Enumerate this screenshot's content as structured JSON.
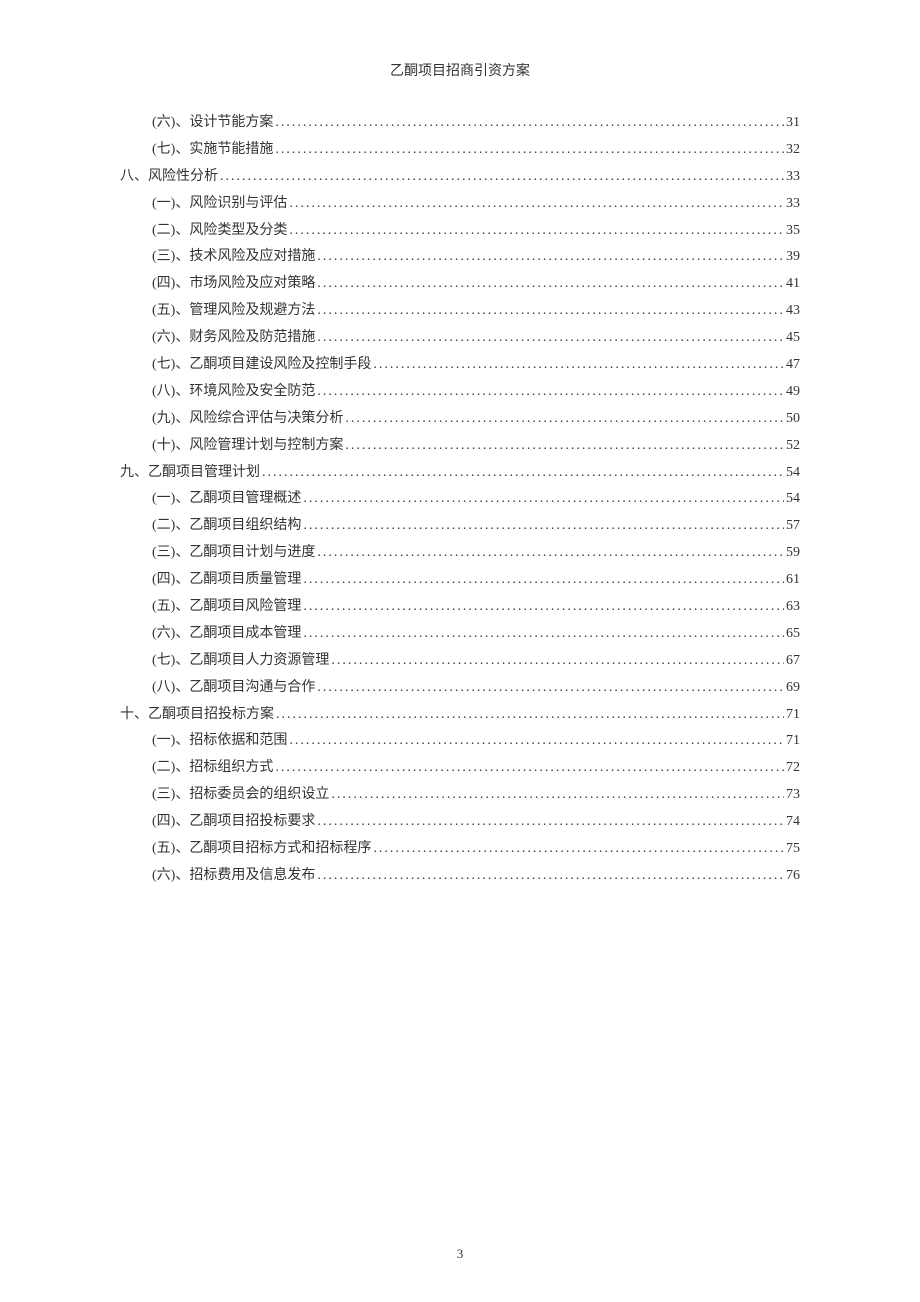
{
  "header": "乙酮项目招商引资方案",
  "page_number": "3",
  "toc_entries": [
    {
      "level": 2,
      "label": "(六)、设计节能方案",
      "page": "31"
    },
    {
      "level": 2,
      "label": "(七)、实施节能措施",
      "page": "32"
    },
    {
      "level": 1,
      "label": "八、风险性分析",
      "page": "33"
    },
    {
      "level": 2,
      "label": "(一)、风险识别与评估",
      "page": "33"
    },
    {
      "level": 2,
      "label": "(二)、风险类型及分类",
      "page": "35"
    },
    {
      "level": 2,
      "label": "(三)、技术风险及应对措施",
      "page": "39"
    },
    {
      "level": 2,
      "label": "(四)、市场风险及应对策略",
      "page": "41"
    },
    {
      "level": 2,
      "label": "(五)、管理风险及规避方法",
      "page": "43"
    },
    {
      "level": 2,
      "label": "(六)、财务风险及防范措施",
      "page": "45"
    },
    {
      "level": 2,
      "label": "(七)、乙酮项目建设风险及控制手段",
      "page": "47"
    },
    {
      "level": 2,
      "label": "(八)、环境风险及安全防范",
      "page": "49"
    },
    {
      "level": 2,
      "label": "(九)、风险综合评估与决策分析",
      "page": "50"
    },
    {
      "level": 2,
      "label": "(十)、风险管理计划与控制方案",
      "page": "52"
    },
    {
      "level": 1,
      "label": "九、乙酮项目管理计划",
      "page": "54"
    },
    {
      "level": 2,
      "label": "(一)、乙酮项目管理概述",
      "page": "54"
    },
    {
      "level": 2,
      "label": "(二)、乙酮项目组织结构",
      "page": "57"
    },
    {
      "level": 2,
      "label": "(三)、乙酮项目计划与进度",
      "page": "59"
    },
    {
      "level": 2,
      "label": "(四)、乙酮项目质量管理",
      "page": "61"
    },
    {
      "level": 2,
      "label": "(五)、乙酮项目风险管理",
      "page": "63"
    },
    {
      "level": 2,
      "label": "(六)、乙酮项目成本管理",
      "page": "65"
    },
    {
      "level": 2,
      "label": "(七)、乙酮项目人力资源管理",
      "page": "67"
    },
    {
      "level": 2,
      "label": "(八)、乙酮项目沟通与合作",
      "page": "69"
    },
    {
      "level": 1,
      "label": "十、乙酮项目招投标方案",
      "page": "71"
    },
    {
      "level": 2,
      "label": "(一)、招标依据和范围",
      "page": "71"
    },
    {
      "level": 2,
      "label": "(二)、招标组织方式",
      "page": "72"
    },
    {
      "level": 2,
      "label": "(三)、招标委员会的组织设立",
      "page": "73"
    },
    {
      "level": 2,
      "label": "(四)、乙酮项目招投标要求",
      "page": "74"
    },
    {
      "level": 2,
      "label": "(五)、乙酮项目招标方式和招标程序",
      "page": "75"
    },
    {
      "level": 2,
      "label": "(六)、招标费用及信息发布",
      "page": "76"
    }
  ]
}
